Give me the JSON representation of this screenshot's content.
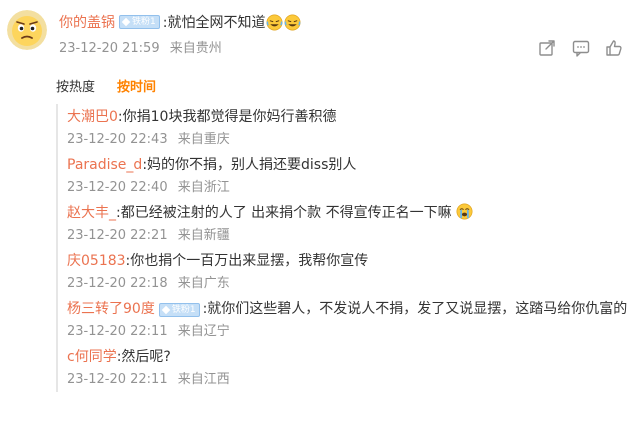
{
  "main_comment": {
    "author": "你的盖锅",
    "badge": "铁粉1",
    "text": ":就怕全网不知道",
    "emojis": [
      "laughing-crying-emoji",
      "laughing-crying-emoji"
    ],
    "time": "23-12-20 21:59",
    "location": "来自贵州"
  },
  "actions": {
    "share": "share-icon",
    "comment": "comment-icon",
    "like": "thumbs-up-icon"
  },
  "sort": {
    "by_hot": "按热度",
    "by_time": "按时间",
    "active": "by_time"
  },
  "replies": [
    {
      "user": "大潮巴0",
      "badge": "",
      "text": ":你捐10块我都觉得是你妈行善积德",
      "emoji": "",
      "time": "23-12-20 22:43",
      "location": "来自重庆"
    },
    {
      "user": "Paradise_d",
      "badge": "",
      "text": ":妈的你不捐，别人捐还要diss别人",
      "emoji": "",
      "time": "23-12-20 22:40",
      "location": "来自浙江"
    },
    {
      "user": "赵大丰_",
      "badge": "",
      "text": ":都已经被注射的人了 出来捐个款  不得宣传正名一下嘛",
      "emoji": "crying-emoji",
      "time": "23-12-20 22:21",
      "location": "来自新疆"
    },
    {
      "user": "庆05183",
      "badge": "",
      "text": ":你也捐个一百万出来显摆，我帮你宣传",
      "emoji": "",
      "time": "23-12-20 22:18",
      "location": "来自广东"
    },
    {
      "user": "杨三转了90度",
      "badge": "铁粉1",
      "text": ":就你们这些碧人，不发说人不捐，发了又说显摆，这踏马给你仇富的",
      "emoji": "",
      "time": "23-12-20 22:11",
      "location": "来自辽宁"
    },
    {
      "user": "c何同学",
      "badge": "",
      "text": ":然后呢?",
      "emoji": "",
      "time": "23-12-20 22:11",
      "location": "来自江西"
    }
  ],
  "colors": {
    "username": "#eb7350",
    "meta": "#939393",
    "active_sort": "#ff8200",
    "badge_bg": "#c5dff7"
  }
}
